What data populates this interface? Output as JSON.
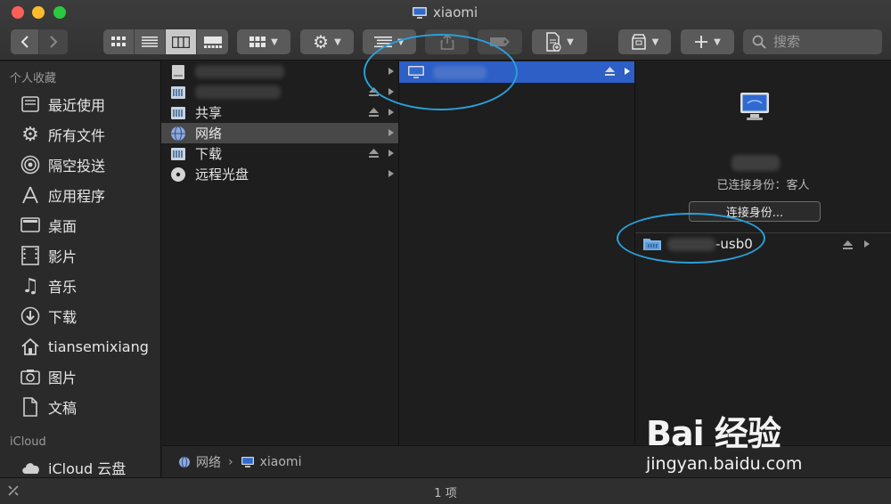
{
  "window": {
    "title": "xiaomi"
  },
  "toolbar": {
    "back_icon": "chevron-left-icon",
    "forward_icon": "chevron-right-icon",
    "view_modes": [
      "icon-view",
      "list-view",
      "column-view",
      "gallery-view"
    ],
    "active_view": "column-view",
    "search_placeholder": "搜索"
  },
  "sidebar": {
    "favorites_header": "个人收藏",
    "favorites": [
      {
        "label": "最近使用",
        "icon": "recents-icon"
      },
      {
        "label": "所有文件",
        "icon": "gear-icon"
      },
      {
        "label": "隔空投送",
        "icon": "airdrop-icon"
      },
      {
        "label": "应用程序",
        "icon": "applications-icon"
      },
      {
        "label": "桌面",
        "icon": "desktop-icon"
      },
      {
        "label": "影片",
        "icon": "movies-icon"
      },
      {
        "label": "音乐",
        "icon": "music-icon"
      },
      {
        "label": "下载",
        "icon": "downloads-icon"
      },
      {
        "label": "tiansemixiang",
        "icon": "home-icon"
      },
      {
        "label": "图片",
        "icon": "camera-icon"
      },
      {
        "label": "文稿",
        "icon": "document-icon"
      }
    ],
    "icloud_header": "iCloud",
    "icloud": [
      {
        "label": "iCloud 云盘",
        "icon": "cloud-icon"
      }
    ]
  },
  "column1": {
    "items": [
      {
        "label": "",
        "blurred": true,
        "icon": "disk-icon"
      },
      {
        "label": "",
        "blurred": true,
        "icon": "server-icon",
        "eject": true
      },
      {
        "label": "共享",
        "icon": "server-icon",
        "eject": true
      },
      {
        "label": "网络",
        "icon": "network-globe-icon",
        "highlighted": true
      },
      {
        "label": "下载",
        "icon": "server-icon",
        "eject": true
      },
      {
        "label": "远程光盘",
        "icon": "optical-disc-icon"
      }
    ]
  },
  "column2": {
    "items": [
      {
        "label": "",
        "blurred": true,
        "icon": "monitor-icon",
        "selected": true,
        "eject": true
      }
    ]
  },
  "preview": {
    "status": "已连接身份：客人",
    "connect_button": "连接身份...",
    "share_suffix": "-usb0"
  },
  "pathbar": {
    "segments": [
      "网络",
      "xiaomi"
    ]
  },
  "status": {
    "count": "1 项"
  },
  "watermark": {
    "brand": "Bai 经验",
    "url": "jingyan.baidu.com"
  },
  "colors": {
    "selection": "#2d5fc6",
    "annotation": "#2a9fd8"
  }
}
